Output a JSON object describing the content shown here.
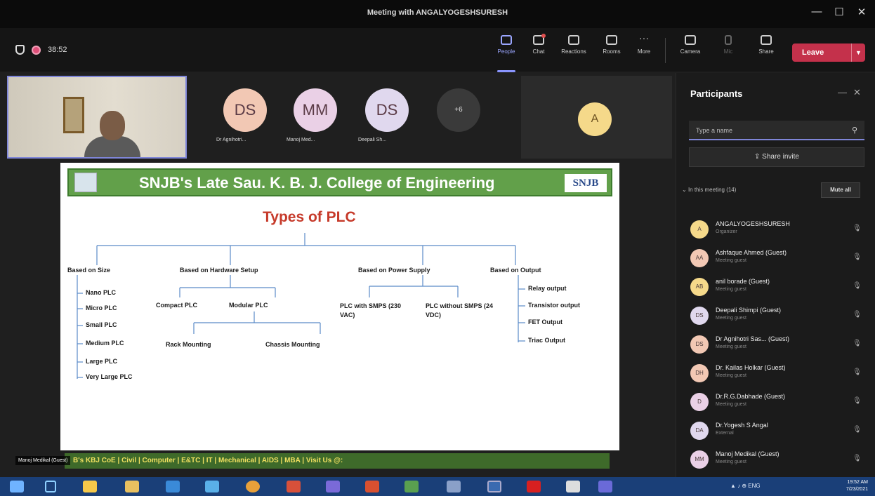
{
  "window": {
    "title": "Meeting with ANGALYOGESHSURESH",
    "minimize": "—",
    "maximize": "☐",
    "close": "✕"
  },
  "toolbar": {
    "timer": "38:52",
    "buttons": [
      {
        "label": "People",
        "icon": "people-icon"
      },
      {
        "label": "Chat",
        "icon": "chat-icon"
      },
      {
        "label": "Reactions",
        "icon": "reactions-icon"
      },
      {
        "label": "Rooms",
        "icon": "rooms-icon"
      },
      {
        "label": "More",
        "icon": "more-icon"
      },
      {
        "label": "Camera",
        "icon": "camera-icon"
      },
      {
        "label": "Mic",
        "icon": "mic-icon"
      },
      {
        "label": "Share",
        "icon": "share-icon"
      }
    ],
    "leave_label": "Leave"
  },
  "video_strip": {
    "avatars": [
      {
        "initials": "DS",
        "caption": "Dr Agnihotri..."
      },
      {
        "initials": "MM",
        "caption": "Manoj Med..."
      },
      {
        "initials": "DS",
        "caption": "Deepali Sh..."
      }
    ],
    "more_count": "+6",
    "spotlight_initial": "A"
  },
  "slide": {
    "header": "SNJB's Late Sau. K. B. J. College of Engineering",
    "logo_right": "SNJB",
    "title": "Types of PLC",
    "categories": [
      {
        "label": "Based on Size",
        "items": [
          "Nano PLC",
          "Micro PLC",
          "Small PLC",
          "Medium PLC",
          "Large PLC",
          "Very Large PLC"
        ]
      },
      {
        "label": "Based on Hardware Setup",
        "items": [
          "Compact PLC",
          "Modular PLC"
        ],
        "sub_items": [
          "Rack Mounting",
          "Chassis Mounting"
        ]
      },
      {
        "label": "Based on Power Supply",
        "items": [
          "PLC with SMPS (230 VAC)",
          "PLC without SMPS (24 VDC)"
        ]
      },
      {
        "label": "Based on Output",
        "items": [
          "Relay output",
          "Transistor output",
          "FET Output",
          "Triac Output"
        ]
      }
    ],
    "banner": "B's KBJ CoE | Civil | Computer | E&TC | IT | Mechanical | AIDS | MBA | Visit Us @:",
    "presenter_tag": "Manoj Medikal (Guest)"
  },
  "participants": {
    "title": "Participants",
    "search_placeholder": "Type a name",
    "share_invite": "Share invite",
    "section_label": "In this meeting (14)",
    "mute_all": "Mute all",
    "list": [
      {
        "initials": "A",
        "name": "ANGALYOGESHSURESH",
        "role": "Organizer",
        "color": "#f5d98a"
      },
      {
        "initials": "AA",
        "name": "Ashfaque Ahmed (Guest)",
        "role": "Meeting guest",
        "color": "#f2c8b4"
      },
      {
        "initials": "AB",
        "name": "anil borade (Guest)",
        "role": "Meeting guest",
        "color": "#f5d98a"
      },
      {
        "initials": "DS",
        "name": "Deepali Shimpi (Guest)",
        "role": "Meeting guest",
        "color": "#e0d8ee"
      },
      {
        "initials": "DS",
        "name": "Dr Agnihotri Sas... (Guest)",
        "role": "Meeting guest",
        "color": "#f2c8b4"
      },
      {
        "initials": "DH",
        "name": "Dr. Kailas Holkar (Guest)",
        "role": "Meeting guest",
        "color": "#f2c8b4"
      },
      {
        "initials": "D",
        "name": "Dr.R.G.Dabhade (Guest)",
        "role": "Meeting guest",
        "color": "#ead0e6"
      },
      {
        "initials": "DA",
        "name": "Dr.Yogesh S Angal",
        "role": "External",
        "color": "#e0d8ee"
      },
      {
        "initials": "MM",
        "name": "Manoj Medikal (Guest)",
        "role": "Meeting guest",
        "color": "#ead0e6"
      }
    ]
  },
  "taskbar": {
    "tray": "▲ ♪ ⊕ ENG",
    "time": "19:52 AM",
    "date": "7/23/2021"
  }
}
